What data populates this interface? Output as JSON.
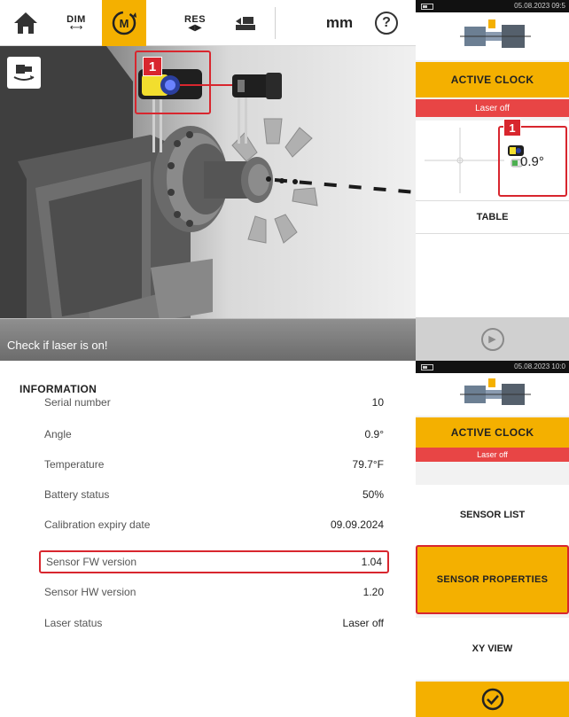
{
  "top": {
    "toolbar": {
      "home_icon": "home-icon",
      "dim_label": "DIM",
      "measure_label": "M",
      "res_label": "RES",
      "unit_label": "mm",
      "help_label": "?"
    },
    "scene": {
      "callout_number": "1",
      "status_message": "Check if laser is on!"
    },
    "right_panel": {
      "phone_time": "05.08.2023 09:5",
      "mode_label": "ACTIVE CLOCK",
      "laser_status": "Laser off",
      "callout_number": "1",
      "angle_value": "0.9°",
      "table_label": "TABLE"
    }
  },
  "bottom": {
    "info_title": "INFORMATION",
    "rows": [
      {
        "label": "Serial number",
        "value": "10"
      },
      {
        "label": "Angle",
        "value": "0.9°"
      },
      {
        "label": "Temperature",
        "value": "79.7°F"
      },
      {
        "label": "Battery status",
        "value": "50%"
      },
      {
        "label": "Calibration expiry date",
        "value": "09.09.2024"
      },
      {
        "label": "Sensor FW version",
        "value": "1.04"
      },
      {
        "label": "Sensor HW version",
        "value": "1.20"
      },
      {
        "label": "Laser status",
        "value": "Laser off"
      }
    ],
    "right_panel": {
      "phone_time": "05.08.2023 10:0",
      "mode_label": "ACTIVE CLOCK",
      "laser_status": "Laser off",
      "sensor_list_label": "SENSOR LIST",
      "sensor_properties_label": "SENSOR PROPERTIES",
      "xy_view_label": "XY VIEW",
      "confirm_icon": "check-circle-icon"
    }
  },
  "colors": {
    "accent": "#f4b000",
    "alert": "#e84545",
    "highlight": "#d8262e"
  }
}
